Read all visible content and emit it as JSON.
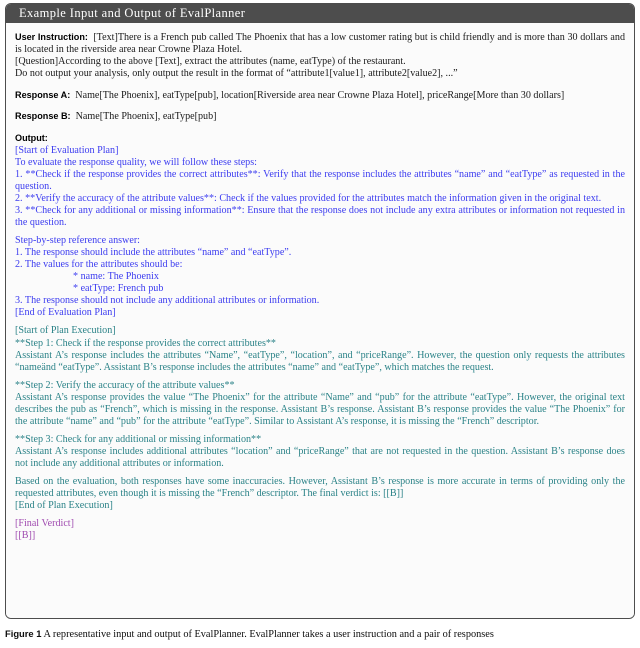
{
  "box": {
    "title": "Example Input and Output of EvalPlanner"
  },
  "input": {
    "user_instruction_label": "User Instruction:",
    "user_instruction_lines": [
      "[Text]There is a French pub called The Phoenix that has a low customer rating but is child friendly and is more than 30 dollars and is located in the riverside area near Crowne Plaza Hotel.",
      "[Question]According to the above [Text], extract the attributes (name, eatType) of the restaurant.",
      "Do not output your analysis, only output the result in the format of “attribute1[value1], attribute2[value2], ...”"
    ],
    "response_a_label": "Response A:",
    "response_a_text": "Name[The Phoenix], eatType[pub], location[Riverside area near Crowne Plaza Hotel], priceRange[More than 30 dollars]",
    "response_b_label": "Response B:",
    "response_b_text": "Name[The Phoenix], eatType[pub]"
  },
  "output": {
    "output_label": "Output:",
    "evaluation_plan": {
      "start_tag": "[Start of Evaluation Plan]",
      "intro": "To evaluate the response quality, we will follow these steps:",
      "steps": [
        "1. **Check if the response provides the correct attributes**: Verify that the response includes the attributes “name” and “eatType” as requested in the question.",
        "2. **Verify the accuracy of the attribute values**: Check if the values provided for the attributes match the information given in the original text.",
        "3. **Check for any additional or missing information**: Ensure that the response does not include any extra attributes or information not requested in the question."
      ],
      "reference_heading": "Step-by-step reference answer:",
      "reference_items": [
        "1. The response should include the attributes “name” and “eatType”.",
        "2. The values for the attributes should be:"
      ],
      "reference_bullets": [
        "* name: The Phoenix",
        "* eatType: French pub"
      ],
      "reference_last": "3. The response should not include any additional attributes or information.",
      "end_tag": "[End of Evaluation Plan]"
    },
    "plan_execution": {
      "start_tag": "[Start of Plan Execution]",
      "step1_heading": "**Step 1: Check if the response provides the correct attributes**",
      "step1_body": "Assistant A’s response includes the attributes “Name”, “eatType”, “location”, and “priceRange”. However, the question only requests the attributes “nameänd “eatType”. Assistant B’s response includes the attributes “name” and “eatType”, which matches the request.",
      "step2_heading": "**Step 2: Verify the accuracy of the attribute values**",
      "step2_body": "Assistant A’s response provides the value “The Phoenix” for the attribute “Name” and “pub” for the attribute “eatType”. However, the original text describes the pub as “French”, which is missing in the response. Assistant B’s response. Assistant B’s response provides the value “The Phoenix” for the attribute “name” and “pub” for the attribute “eatType”. Similar to Assistant A’s response, it is missing the “French” descriptor.",
      "step3_heading": "**Step 3: Check for any additional or missing information**",
      "step3_body": "Assistant A’s response includes additional attributes “location” and “priceRange” that are not requested in the question. Assistant B’s response does not include any additional attributes or information.",
      "conclusion": "Based on the evaluation, both responses have some inaccuracies. However, Assistant B’s response is more accurate in terms of providing only the requested attributes, even though it is missing the “French” descriptor. The final verdict is: [[B]]",
      "end_tag": "[End of Plan Execution]"
    },
    "final_verdict": {
      "tag": "[Final Verdict]",
      "value": "[[B]]"
    }
  },
  "caption": {
    "lead": "Figure 1",
    "text": "A representative input and output of EvalPlanner. EvalPlanner takes a user instruction and a pair of responses"
  },
  "colors": {
    "plan": "#3c3cf0",
    "execution": "#2a8287",
    "verdict": "#a04bb0",
    "title_bar": "#4d4d4d",
    "box_background": "#fbfbfb"
  }
}
